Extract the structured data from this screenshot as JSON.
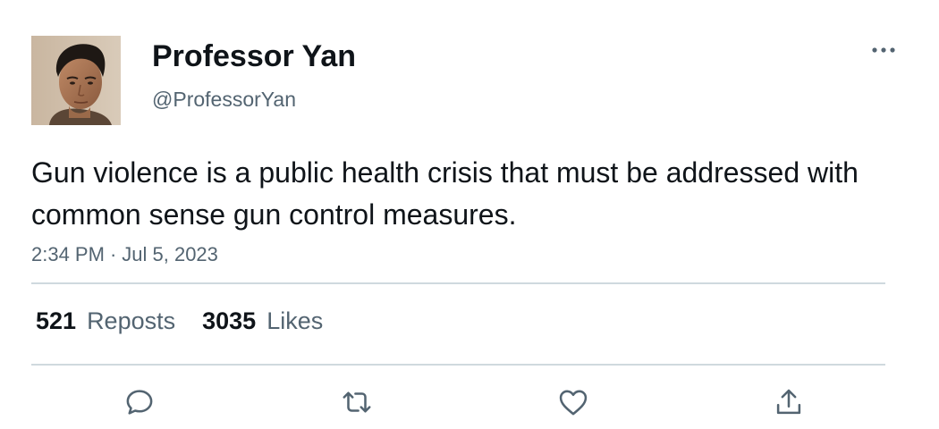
{
  "tweet": {
    "author": {
      "display_name": "Professor Yan",
      "handle": "@ProfessorYan"
    },
    "text": "Gun violence is a public health crisis that must be addressed with common sense gun control measures.",
    "time": "2:34 PM",
    "date": "Jul 5, 2023",
    "separator": "·",
    "stats": {
      "reposts_count": "521",
      "reposts_label": "Reposts",
      "likes_count": "3035",
      "likes_label": "Likes"
    }
  },
  "icons": {
    "more": "more-horizontal-icon",
    "reply": "reply-icon",
    "repost": "repost-icon",
    "like": "heart-icon",
    "share": "share-icon"
  },
  "colors": {
    "text": "#0f1419",
    "secondary_text": "#536471",
    "divider": "#cfd9de",
    "icon": "#536471"
  }
}
